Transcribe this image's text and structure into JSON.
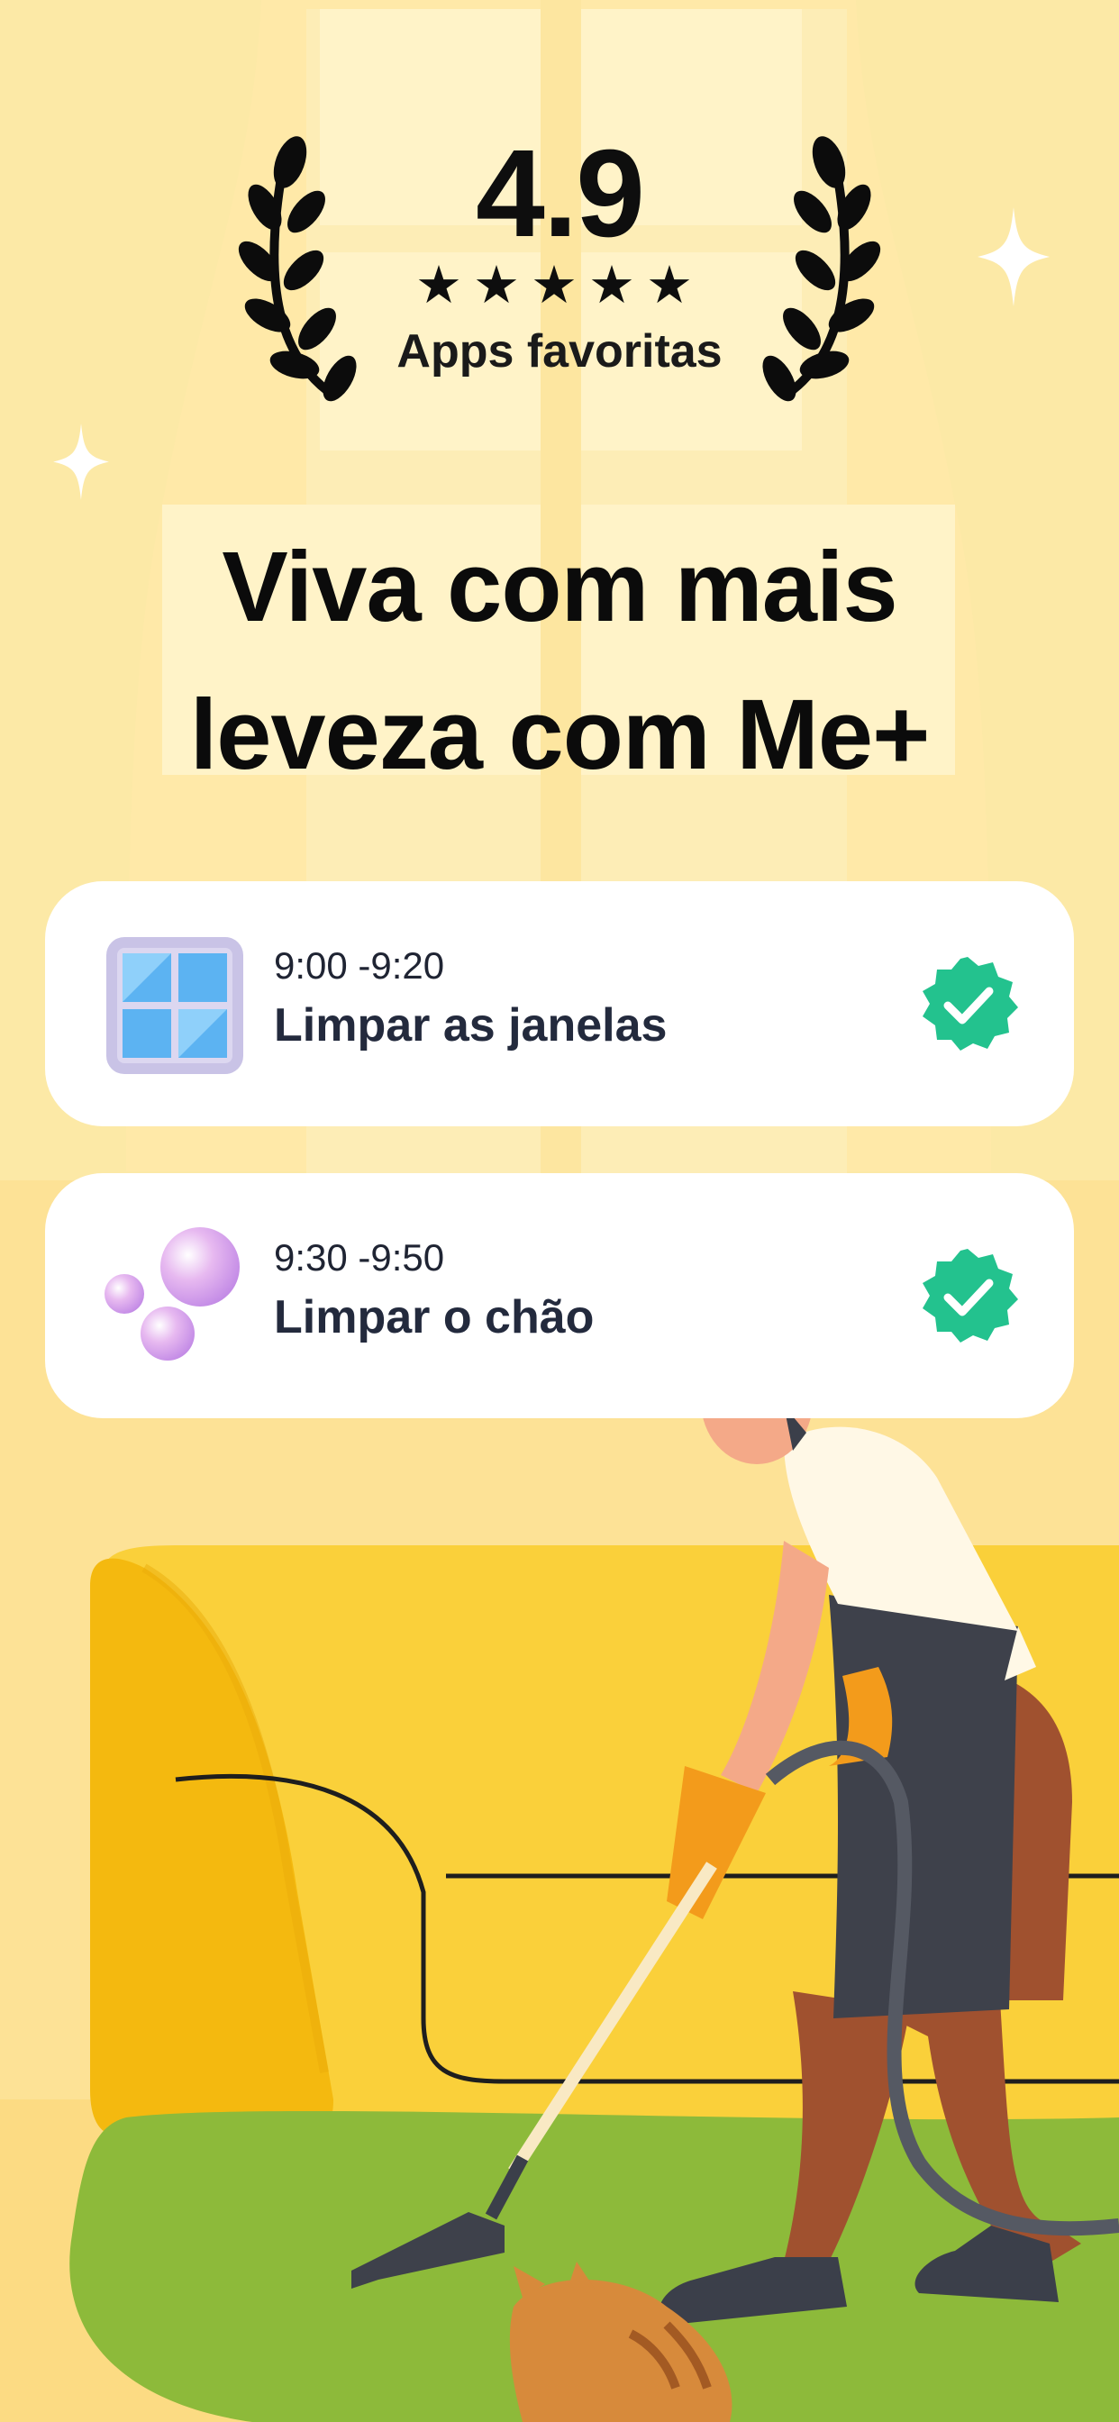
{
  "rating": {
    "score": "4.9",
    "stars": "★★★★★",
    "label": "Apps favoritas"
  },
  "headline": {
    "line1": "Viva com mais",
    "line2": "leveza com Me+"
  },
  "tasks": [
    {
      "time": "9:00 -9:20",
      "title": "Limpar as janelas",
      "icon": "window-icon",
      "done": true
    },
    {
      "time": "9:30 -9:50",
      "title": "Limpar o chão",
      "icon": "bubbles-icon",
      "done": true
    }
  ],
  "colors": {
    "background": "#FCE9A6",
    "sofa": "#F9C832",
    "rug": "#8DBA3A",
    "check": "#23C28E"
  }
}
